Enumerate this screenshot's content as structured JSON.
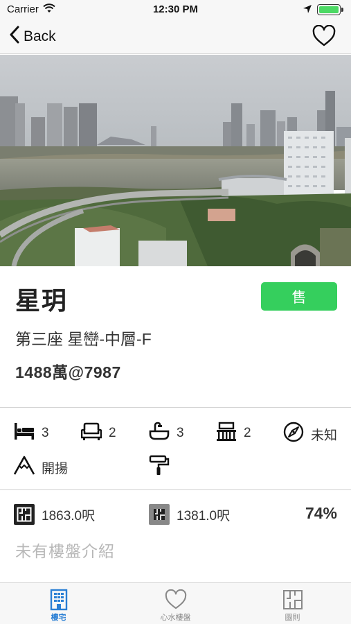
{
  "status_bar": {
    "carrier": "Carrier",
    "time": "12:30 PM"
  },
  "nav": {
    "back_label": "Back",
    "back_icon": "chevron-left-icon",
    "favorite_icon": "heart-outline-icon"
  },
  "property": {
    "name": "星玥",
    "status_badge": "售",
    "address": "第三座 星巒-中層-F",
    "price": "1488萬@7987",
    "accent_color": "#35cf5d"
  },
  "features": {
    "bedrooms": "3",
    "living_rooms": "2",
    "bathrooms": "3",
    "balconies": "2",
    "facing": "未知",
    "view": "開揚",
    "decoration": ""
  },
  "area": {
    "gross": "1863.0呎",
    "saleable": "1381.0呎",
    "efficiency": "74%"
  },
  "intro": "未有樓盤介紹",
  "tabs": [
    {
      "label": "樓宅",
      "icon": "building-icon",
      "active": true
    },
    {
      "label": "心水樓盤",
      "icon": "heart-icon",
      "active": false
    },
    {
      "label": "圖則",
      "icon": "floorplan-icon",
      "active": false
    }
  ],
  "colors": {
    "active_tab": "#2a7fd4",
    "inactive_tab": "#888888"
  }
}
